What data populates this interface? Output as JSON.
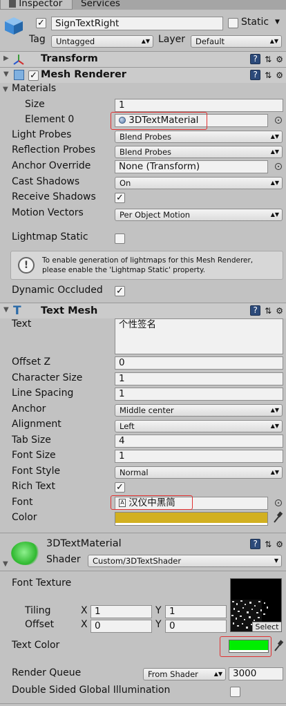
{
  "tabs": {
    "inspector": "Inspector",
    "services": "Services"
  },
  "object": {
    "name": "SignTextRight",
    "static_label": "Static",
    "tag_label": "Tag",
    "tag_value": "Untagged",
    "layer_label": "Layer",
    "layer_value": "Default"
  },
  "transform": {
    "title": "Transform"
  },
  "mesh_renderer": {
    "title": "Mesh Renderer",
    "materials_label": "Materials",
    "size_label": "Size",
    "size_value": "1",
    "element0_label": "Element 0",
    "element0_value": "3DTextMaterial",
    "light_probes_label": "Light Probes",
    "light_probes_value": "Blend Probes",
    "reflection_probes_label": "Reflection Probes",
    "reflection_probes_value": "Blend Probes",
    "anchor_override_label": "Anchor Override",
    "anchor_override_value": "None (Transform)",
    "cast_shadows_label": "Cast Shadows",
    "cast_shadows_value": "On",
    "receive_shadows_label": "Receive Shadows",
    "motion_vectors_label": "Motion Vectors",
    "motion_vectors_value": "Per Object Motion",
    "lightmap_static_label": "Lightmap Static",
    "info_text_1": "To enable generation of lightmaps for this Mesh Renderer,",
    "info_text_2": "please enable the 'Lightmap Static' property.",
    "dynamic_occluded_label": "Dynamic Occluded"
  },
  "text_mesh": {
    "title": "Text Mesh",
    "text_label": "Text",
    "text_value": "个性签名",
    "offset_z_label": "Offset Z",
    "offset_z_value": "0",
    "char_size_label": "Character Size",
    "char_size_value": "1",
    "line_spacing_label": "Line Spacing",
    "line_spacing_value": "1",
    "anchor_label": "Anchor",
    "anchor_value": "Middle center",
    "alignment_label": "Alignment",
    "alignment_value": "Left",
    "tab_size_label": "Tab Size",
    "tab_size_value": "4",
    "font_size_label": "Font Size",
    "font_size_value": "1",
    "font_style_label": "Font Style",
    "font_style_value": "Normal",
    "rich_text_label": "Rich Text",
    "font_label": "Font",
    "font_value": "汉仪中黑简",
    "color_label": "Color",
    "color_hex": "#d2b020"
  },
  "material": {
    "name": "3DTextMaterial",
    "shader_label": "Shader",
    "shader_value": "Custom/3DTextShader",
    "font_texture_label": "Font Texture",
    "tiling_label": "Tiling",
    "tiling_x": "1",
    "tiling_y": "1",
    "offset_label": "Offset",
    "offset_x": "0",
    "offset_y": "0",
    "x_label": "X",
    "y_label": "Y",
    "select_label": "Select",
    "text_color_label": "Text Color",
    "text_color_hex": "#00ee00",
    "render_queue_label": "Render Queue",
    "render_queue_mode": "From Shader",
    "render_queue_value": "3000",
    "double_sided_label": "Double Sided Global Illumination"
  }
}
